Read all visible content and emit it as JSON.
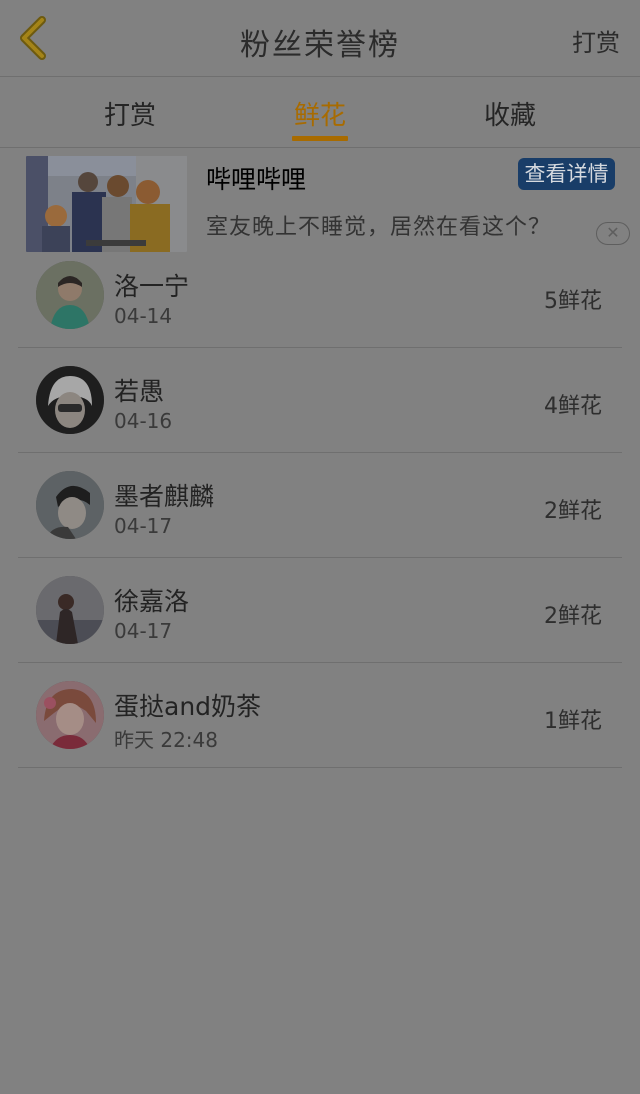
{
  "header": {
    "title": "粉丝荣誉榜",
    "right_label": "打赏",
    "accent_color": "#a86b00"
  },
  "tabs": [
    {
      "label": "打赏",
      "active": false
    },
    {
      "label": "鲜花",
      "active": true
    },
    {
      "label": "收藏",
      "active": false
    }
  ],
  "ad": {
    "title": "哔哩哔哩",
    "subtitle": "室友晚上不睡觉，居然在看这个？",
    "button_label": "查看详情",
    "close_label": "✕"
  },
  "fans": [
    {
      "name": "洛一宁",
      "date": "04-14",
      "count": "5鲜花"
    },
    {
      "name": "若愚",
      "date": "04-16",
      "count": "4鲜花"
    },
    {
      "name": "墨者麒麟",
      "date": "04-17",
      "count": "2鲜花"
    },
    {
      "name": "徐嘉洛",
      "date": "04-17",
      "count": "2鲜花"
    },
    {
      "name": "蛋挞and奶茶",
      "date": "昨天 22:48",
      "count": "1鲜花"
    }
  ]
}
